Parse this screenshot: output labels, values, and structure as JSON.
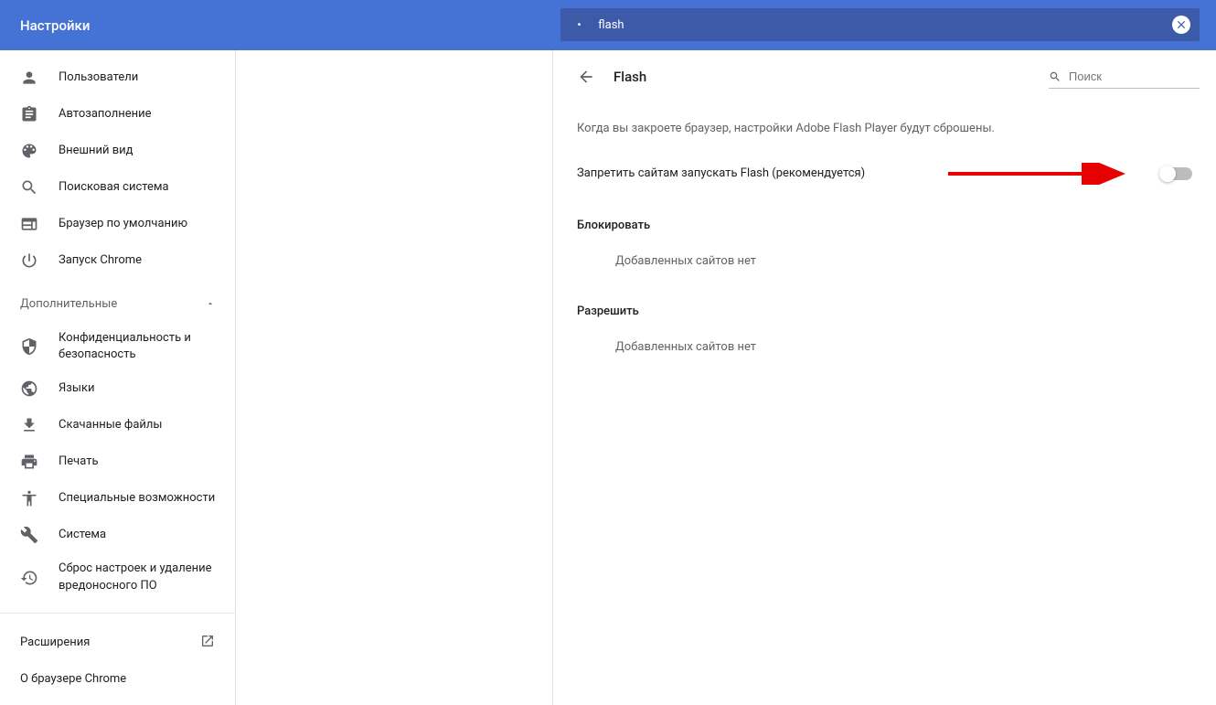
{
  "header": {
    "title": "Настройки"
  },
  "searchBar": {
    "query": "flash"
  },
  "sidebar": {
    "items": [
      {
        "label": "Пользователи"
      },
      {
        "label": "Автозаполнение"
      },
      {
        "label": "Внешний вид"
      },
      {
        "label": "Поисковая система"
      },
      {
        "label": "Браузер по умолчанию"
      },
      {
        "label": "Запуск Chrome"
      }
    ],
    "advancedLabel": "Дополнительные",
    "advanced": [
      {
        "label": "Конфиденциальность и безопасность"
      },
      {
        "label": "Языки"
      },
      {
        "label": "Скачанные файлы"
      },
      {
        "label": "Печать"
      },
      {
        "label": "Специальные возможности"
      },
      {
        "label": "Система"
      },
      {
        "label": "Сброс настроек и удаление вредоносного ПО"
      }
    ],
    "extensions": "Расширения",
    "about": "О браузере Chrome"
  },
  "page": {
    "title": "Flash",
    "searchPlaceholder": "Поиск",
    "notice": "Когда вы закроете браузер, настройки Adobe Flash Player будут сброшены.",
    "toggleLabel": "Запретить сайтам запускать Flash (рекомендуется)",
    "blockTitle": "Блокировать",
    "blockEmpty": "Добавленных сайтов нет",
    "allowTitle": "Разрешить",
    "allowEmpty": "Добавленных сайтов нет"
  }
}
